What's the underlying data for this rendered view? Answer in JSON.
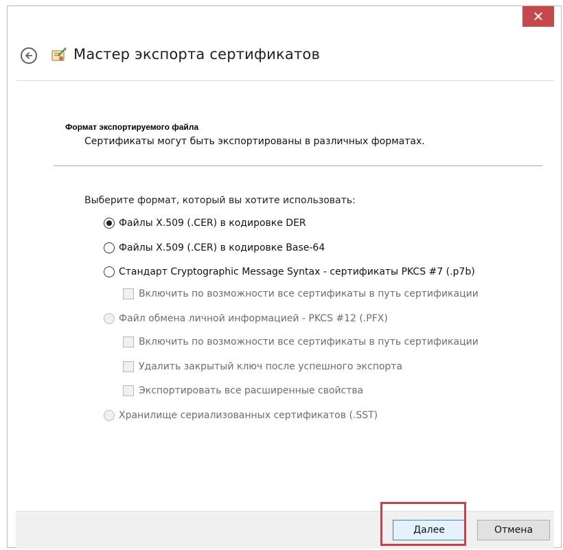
{
  "window": {
    "title": "Мастер экспорта сертификатов",
    "close_symbol": "✕"
  },
  "icons": {
    "back": "back-arrow-icon",
    "wizard": "certificate-wizard-icon",
    "close": "close-icon"
  },
  "section": {
    "title": "Формат экспортируемого файла",
    "description": "Сертификаты могут быть экспортированы в различных форматах."
  },
  "prompt": "Выберите формат, который вы хотите использовать:",
  "options": [
    {
      "label": "Файлы X.509 (.CER) в кодировке DER",
      "type": "radio",
      "checked": true,
      "enabled": true
    },
    {
      "label": "Файлы X.509 (.CER) в кодировке Base-64",
      "type": "radio",
      "checked": false,
      "enabled": true
    },
    {
      "label": "Стандарт Cryptographic Message Syntax - сертификаты PKCS #7 (.p7b)",
      "type": "radio",
      "checked": false,
      "enabled": true
    },
    {
      "label": "Включить по возможности все сертификаты в путь сертификации",
      "type": "checkbox",
      "checked": false,
      "enabled": false
    },
    {
      "label": "Файл обмена личной информацией - PKCS #12 (.PFX)",
      "type": "radio",
      "checked": false,
      "enabled": false
    },
    {
      "label": "Включить по возможности все сертификаты в путь сертификации",
      "type": "checkbox",
      "checked": false,
      "enabled": false
    },
    {
      "label": "Удалить закрытый ключ после успешного экспорта",
      "type": "checkbox",
      "checked": false,
      "enabled": false
    },
    {
      "label": "Экспортировать все расширенные свойства",
      "type": "checkbox",
      "checked": false,
      "enabled": false
    },
    {
      "label": "Хранилище сериализованных сертификатов (.SST)",
      "type": "radio",
      "checked": false,
      "enabled": false
    }
  ],
  "buttons": {
    "next": "Далее",
    "cancel": "Отмена"
  },
  "colors": {
    "close_bg": "#c7494b",
    "highlight": "#c5444a",
    "primary_border": "#3c7fb1"
  }
}
